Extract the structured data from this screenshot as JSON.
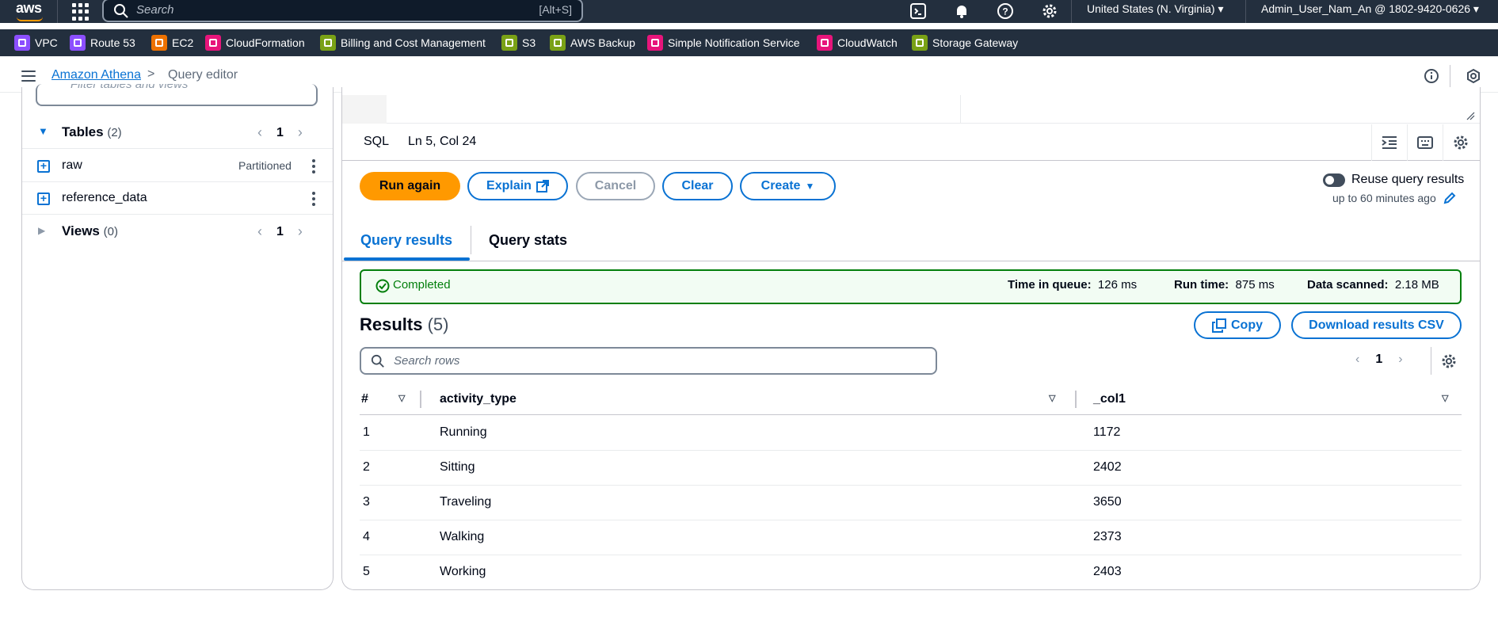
{
  "topbar": {
    "logo": "aws",
    "search_placeholder": "Search",
    "search_shortcut": "[Alt+S]",
    "region": "United States (N. Virginia)",
    "account": "Admin_User_Nam_An @ 1802-9420-0626"
  },
  "favorites": [
    {
      "label": "VPC",
      "color": "#8c4fff"
    },
    {
      "label": "Route 53",
      "color": "#8c4fff"
    },
    {
      "label": "EC2",
      "color": "#ed7100"
    },
    {
      "label": "CloudFormation",
      "color": "#e7157b"
    },
    {
      "label": "Billing and Cost Management",
      "color": "#7aa116"
    },
    {
      "label": "S3",
      "color": "#7aa116"
    },
    {
      "label": "AWS Backup",
      "color": "#7aa116"
    },
    {
      "label": "Simple Notification Service",
      "color": "#e7157b"
    },
    {
      "label": "CloudWatch",
      "color": "#e7157b"
    },
    {
      "label": "Storage Gateway",
      "color": "#7aa116"
    }
  ],
  "breadcrumb": {
    "link": "Amazon Athena",
    "separator": ">",
    "current": "Query editor"
  },
  "left_panel": {
    "filter_placeholder": "Filter tables and views",
    "tables_title": "Tables",
    "tables_count": "(2)",
    "tables_page": "1",
    "tables": [
      {
        "name": "raw",
        "badge": "Partitioned"
      },
      {
        "name": "reference_data",
        "badge": ""
      }
    ],
    "views_title": "Views",
    "views_count": "(0)",
    "views_page": "1"
  },
  "editor": {
    "language": "SQL",
    "cursor_position": "Ln 5, Col 24"
  },
  "actions": {
    "run_again": "Run again",
    "explain": "Explain",
    "cancel": "Cancel",
    "clear": "Clear",
    "create": "Create",
    "reuse_label": "Reuse query results",
    "reuse_sub": "up to 60 minutes ago",
    "reuse_enabled": false
  },
  "tabs": [
    {
      "label": "Query results",
      "active": true
    },
    {
      "label": "Query stats",
      "active": false
    }
  ],
  "status": {
    "state": "Completed",
    "queue_label": "Time in queue:",
    "queue_value": "126 ms",
    "run_label": "Run time:",
    "run_value": "875 ms",
    "scanned_label": "Data scanned:",
    "scanned_value": "2.18 MB"
  },
  "results": {
    "title": "Results",
    "count": "(5)",
    "copy_label": "Copy",
    "download_label": "Download results CSV",
    "search_placeholder": "Search rows",
    "page": "1",
    "columns": [
      "#",
      "activity_type",
      "_col1"
    ],
    "rows": [
      [
        "1",
        "Running",
        "1172"
      ],
      [
        "2",
        "Sitting",
        "2402"
      ],
      [
        "3",
        "Traveling",
        "3650"
      ],
      [
        "4",
        "Walking",
        "2373"
      ],
      [
        "5",
        "Working",
        "2403"
      ]
    ]
  },
  "colors": {
    "primary": "#ff9900",
    "link": "#0972d3",
    "success": "#037f0c",
    "header_bg": "#232f3e"
  }
}
